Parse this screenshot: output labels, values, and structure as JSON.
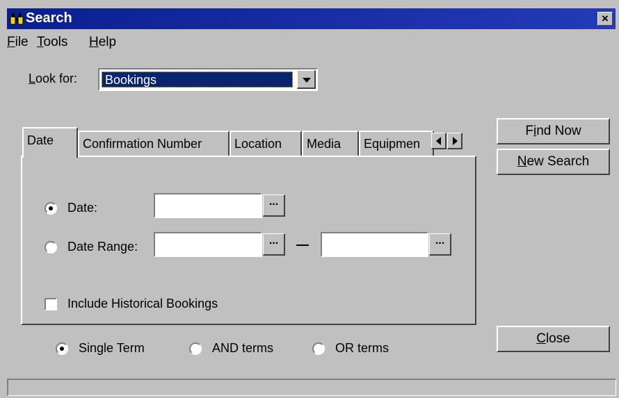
{
  "window": {
    "title": "Search",
    "close_label": "×"
  },
  "menu": {
    "file": {
      "u": "F",
      "rest": "ile"
    },
    "tools": {
      "u": "T",
      "rest": "ools"
    },
    "help": {
      "u": "H",
      "rest": "elp"
    }
  },
  "look_for": {
    "label_u": "L",
    "label_rest": "ook for:",
    "value": "Bookings"
  },
  "buttons": {
    "find_now": {
      "pre": "F",
      "u": "i",
      "rest": "nd Now"
    },
    "new_search": {
      "u": "N",
      "rest": "ew Search"
    },
    "close": {
      "u": "C",
      "rest": "lose"
    }
  },
  "tabs": [
    "Date",
    "Confirmation Number",
    "Location",
    "Media",
    "Equipmen"
  ],
  "date_tab": {
    "date_label": "Date:",
    "range_label": "Date Range:",
    "dots": "...",
    "date_selected": "date",
    "historical_label": "Include Historical Bookings",
    "historical_checked": false
  },
  "terms": {
    "single": "Single Term",
    "and": "AND terms",
    "or": "OR terms",
    "selected": "single"
  },
  "colors": {
    "title_bar": "#0a1f8f",
    "face": "#c0c0c0",
    "selection": "#0a2470"
  }
}
